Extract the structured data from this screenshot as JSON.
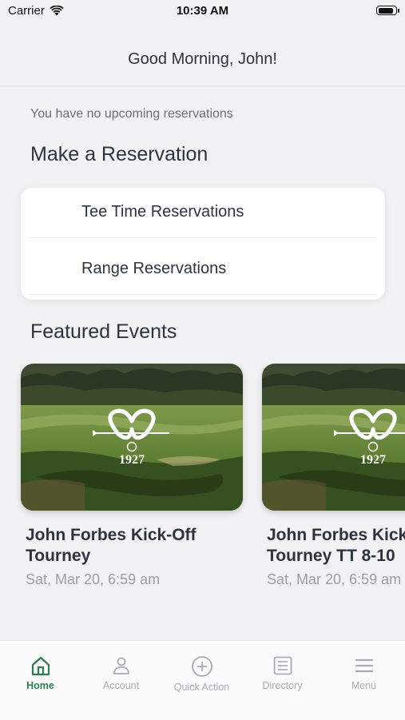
{
  "status_bar": {
    "carrier": "Carrier",
    "time": "10:39 AM",
    "battery_level": 0.9
  },
  "header": {
    "greeting": "Good Morning, John!"
  },
  "reservations": {
    "empty_message": "You have no upcoming reservations",
    "section_title": "Make a Reservation",
    "items": [
      {
        "label": "Tee Time Reservations"
      },
      {
        "label": "Range Reservations"
      }
    ]
  },
  "featured_events": {
    "section_title": "Featured Events",
    "events": [
      {
        "title": "John Forbes Kick-Off\nTourney",
        "date": "Sat, Mar 20, 6:59 am",
        "logo_year": "1927"
      },
      {
        "title": "John Forbes Kick\nTourney TT 8-10",
        "date": "Sat, Mar 20, 6:59 am",
        "logo_year": "1927"
      }
    ]
  },
  "tab_bar": {
    "tabs": [
      {
        "label": "Home",
        "icon": "home-icon",
        "active": true
      },
      {
        "label": "Account",
        "icon": "person-icon",
        "active": false
      },
      {
        "label": "Quick Action",
        "icon": "plus-circle-icon",
        "active": false
      },
      {
        "label": "Directory",
        "icon": "list-icon",
        "active": false
      },
      {
        "label": "Menu",
        "icon": "hamburger-icon",
        "active": false
      }
    ],
    "active_color": "#2e7d4f",
    "inactive_color": "#a8acb2"
  }
}
